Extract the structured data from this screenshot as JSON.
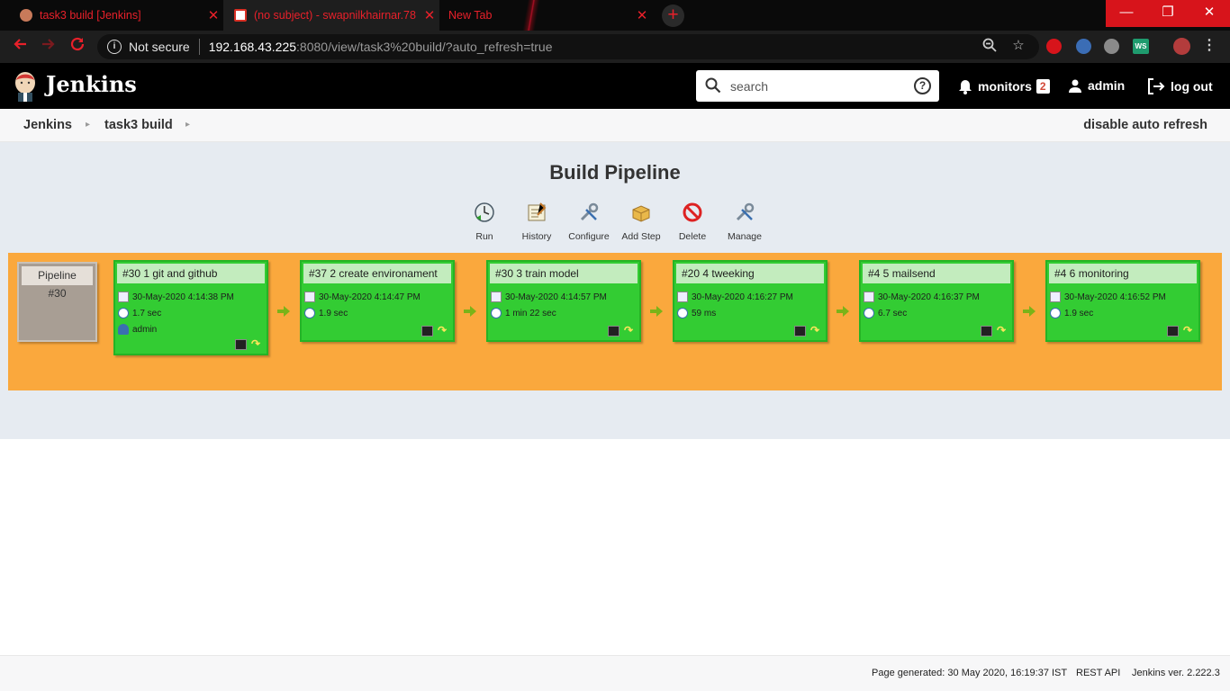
{
  "browser": {
    "tabs": [
      {
        "title": "task3 build [Jenkins]",
        "active": false
      },
      {
        "title": "(no subject) - swapnilkhairnar.78",
        "active": true
      },
      {
        "title": "New Tab",
        "active": false
      }
    ],
    "new_tab_symbol": "+",
    "close_symbol": "✕",
    "window_controls": {
      "minimize": "—",
      "restore": "❐",
      "close": "✕"
    },
    "address": {
      "security": "Not secure",
      "host": "192.168.43.225",
      "path": ":8080/view/task3%20build/?auto_refresh=true"
    }
  },
  "jenkins": {
    "brand": "Jenkins",
    "search": {
      "placeholder": "search",
      "help_symbol": "?"
    },
    "monitors_label": "monitors",
    "monitors_count": "2",
    "user_label": "admin",
    "logout_label": "log out"
  },
  "breadcrumb": {
    "items": [
      "Jenkins",
      "task3 build"
    ],
    "action": "disable auto refresh"
  },
  "page": {
    "title": "Build Pipeline",
    "toolbar": [
      "Run",
      "History",
      "Configure",
      "Add Step",
      "Delete",
      "Manage"
    ]
  },
  "pipeline": {
    "label": "Pipeline",
    "number": "#30",
    "jobs": [
      {
        "title": "#30 1 git and github",
        "date": "30-May-2020 4:14:38 PM",
        "duration": "1.7 sec",
        "user": "admin"
      },
      {
        "title": "#37 2 create environament",
        "date": "30-May-2020 4:14:47 PM",
        "duration": "1.9 sec"
      },
      {
        "title": "#30 3 train model",
        "date": "30-May-2020 4:14:57 PM",
        "duration": "1 min 22 sec"
      },
      {
        "title": "#20 4 tweeking",
        "date": "30-May-2020 4:16:27 PM",
        "duration": "59 ms"
      },
      {
        "title": "#4 5 mailsend",
        "date": "30-May-2020 4:16:37 PM",
        "duration": "6.7 sec"
      },
      {
        "title": "#4 6 monitoring",
        "date": "30-May-2020 4:16:52 PM",
        "duration": "1.9 sec"
      }
    ],
    "colors": {
      "success": "#33cc33",
      "success_header": "#c3ecbe",
      "background": "#faa83d"
    }
  },
  "footer": {
    "generated": "Page generated: 30 May 2020, 16:19:37 IST",
    "rest_api": "REST API",
    "version": "Jenkins ver. 2.222.3"
  }
}
